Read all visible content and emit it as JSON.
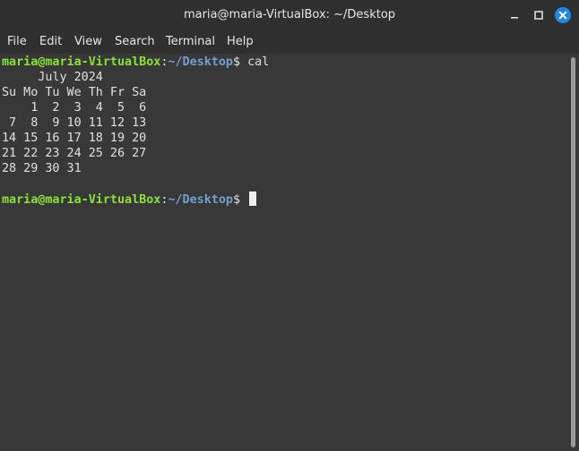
{
  "window": {
    "title": "maria@maria-VirtualBox: ~/Desktop",
    "close_color": "#1e88e5",
    "min_icon": "minimize-icon",
    "max_icon": "maximize-icon",
    "close_icon": "close-icon"
  },
  "menu": {
    "file": "File",
    "edit": "Edit",
    "view": "View",
    "search": "Search",
    "terminal": "Terminal",
    "help": "Help"
  },
  "terminal": {
    "prompt_user": "maria@maria-VirtualBox",
    "prompt_sep": ":",
    "prompt_path": "~/Desktop",
    "prompt_symbol": "$ ",
    "command": "cal",
    "output": [
      "     July 2024",
      "Su Mo Tu We Th Fr Sa",
      "    1  2  3  4  5  6",
      " 7  8  9 10 11 12 13",
      "14 15 16 17 18 19 20",
      "21 22 23 24 25 26 27",
      "28 29 30 31"
    ],
    "user_color": "#8ae234",
    "path_color": "#729fcf"
  }
}
